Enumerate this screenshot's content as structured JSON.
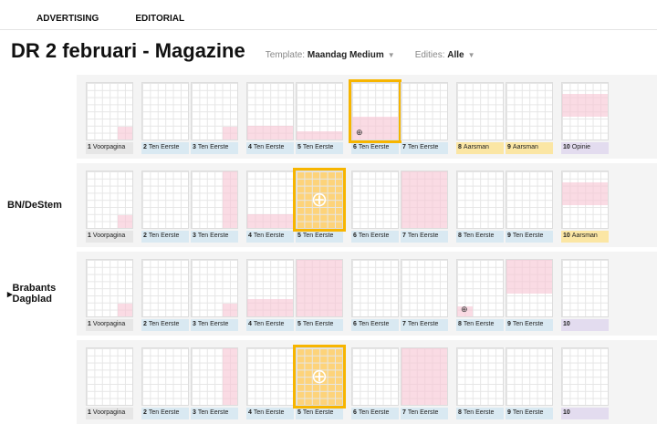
{
  "nav": {
    "items": [
      "ADVERTISING",
      "EDITORIAL"
    ]
  },
  "header": {
    "title": "DR 2 februari - Magazine",
    "template_label": "Template:",
    "template_value": "Maandag Medium",
    "editions_label": "Edities:",
    "editions_value": "Alle"
  },
  "colors": {
    "ad": "#f8c8d6",
    "selected": "#f7b500",
    "label_blue": "#d9e9f2",
    "label_yellow": "#fbe6a4",
    "label_purple": "#e3dcef"
  },
  "rows": [
    {
      "label": "",
      "pages": [
        {
          "n": "1",
          "name": "Voorpagina",
          "tag": "grey",
          "ad": "br"
        },
        {
          "n": "2",
          "name": "Ten Eerste",
          "tag": "blue"
        },
        {
          "n": "3",
          "name": "Ten Eerste",
          "tag": "blue",
          "ad": "br"
        },
        {
          "n": "4",
          "name": "Ten Eerste",
          "tag": "blue",
          "ad": "b25"
        },
        {
          "n": "5",
          "name": "Ten Eerste",
          "tag": "blue",
          "ad": "b15"
        },
        {
          "n": "6",
          "name": "Ten Eerste",
          "tag": "blue",
          "ad": "b40",
          "state": "selected",
          "icon": "globe-small"
        },
        {
          "n": "7",
          "name": "Ten Eerste",
          "tag": "blue"
        },
        {
          "n": "8",
          "name": "Aarsman",
          "tag": "yellow"
        },
        {
          "n": "9",
          "name": "Aarsman",
          "tag": "yellow"
        },
        {
          "n": "10",
          "name": "Opinie",
          "tag": "purple",
          "ad": "t40"
        }
      ]
    },
    {
      "label": "BN/DeStem",
      "pages": [
        {
          "n": "1",
          "name": "Voorpagina",
          "tag": "grey",
          "ad": "br"
        },
        {
          "n": "2",
          "name": "Ten Eerste",
          "tag": "blue"
        },
        {
          "n": "3",
          "name": "Ten Eerste",
          "tag": "blue",
          "ad": "r"
        },
        {
          "n": "4",
          "name": "Ten Eerste",
          "tag": "blue",
          "ad": "b25"
        },
        {
          "n": "5",
          "name": "Ten Eerste",
          "tag": "blue",
          "state": "filled",
          "icon": "globe"
        },
        {
          "n": "6",
          "name": "Ten Eerste",
          "tag": "blue"
        },
        {
          "n": "7",
          "name": "Ten Eerste",
          "tag": "blue",
          "ad": "full"
        },
        {
          "n": "8",
          "name": "Ten Eerste",
          "tag": "blue"
        },
        {
          "n": "9",
          "name": "Ten Eerste",
          "tag": "blue"
        },
        {
          "n": "10",
          "name": "Aarsman",
          "tag": "yellow",
          "ad": "t40"
        }
      ]
    },
    {
      "label": "Brabants Dagblad",
      "pages": [
        {
          "n": "1",
          "name": "Voorpagina",
          "tag": "grey",
          "ad": "br"
        },
        {
          "n": "2",
          "name": "Ten Eerste",
          "tag": "blue"
        },
        {
          "n": "3",
          "name": "Ten Eerste",
          "tag": "blue",
          "ad": "br"
        },
        {
          "n": "4",
          "name": "Ten Eerste",
          "tag": "blue",
          "ad": "b30"
        },
        {
          "n": "5",
          "name": "Ten Eerste",
          "tag": "blue",
          "ad": "full"
        },
        {
          "n": "6",
          "name": "Ten Eerste",
          "tag": "blue"
        },
        {
          "n": "7",
          "name": "Ten Eerste",
          "tag": "blue"
        },
        {
          "n": "8",
          "name": "Ten Eerste",
          "tag": "blue",
          "ad": "bl",
          "icon": "globe-small"
        },
        {
          "n": "9",
          "name": "Ten Eerste",
          "tag": "blue",
          "ad": "t60"
        },
        {
          "n": "10",
          "name": "",
          "tag": "purple"
        }
      ]
    },
    {
      "label": "",
      "pages": [
        {
          "n": "1",
          "name": "Voorpagina",
          "tag": "grey"
        },
        {
          "n": "2",
          "name": "Ten Eerste",
          "tag": "blue"
        },
        {
          "n": "3",
          "name": "Ten Eerste",
          "tag": "blue",
          "ad": "r"
        },
        {
          "n": "4",
          "name": "Ten Eerste",
          "tag": "blue"
        },
        {
          "n": "5",
          "name": "Ten Eerste",
          "tag": "blue",
          "state": "filled",
          "icon": "globe"
        },
        {
          "n": "6",
          "name": "Ten Eerste",
          "tag": "blue"
        },
        {
          "n": "7",
          "name": "Ten Eerste",
          "tag": "blue",
          "ad": "full"
        },
        {
          "n": "8",
          "name": "Ten Eerste",
          "tag": "blue"
        },
        {
          "n": "9",
          "name": "Ten Eerste",
          "tag": "blue"
        },
        {
          "n": "10",
          "name": "",
          "tag": "purple"
        }
      ]
    }
  ]
}
